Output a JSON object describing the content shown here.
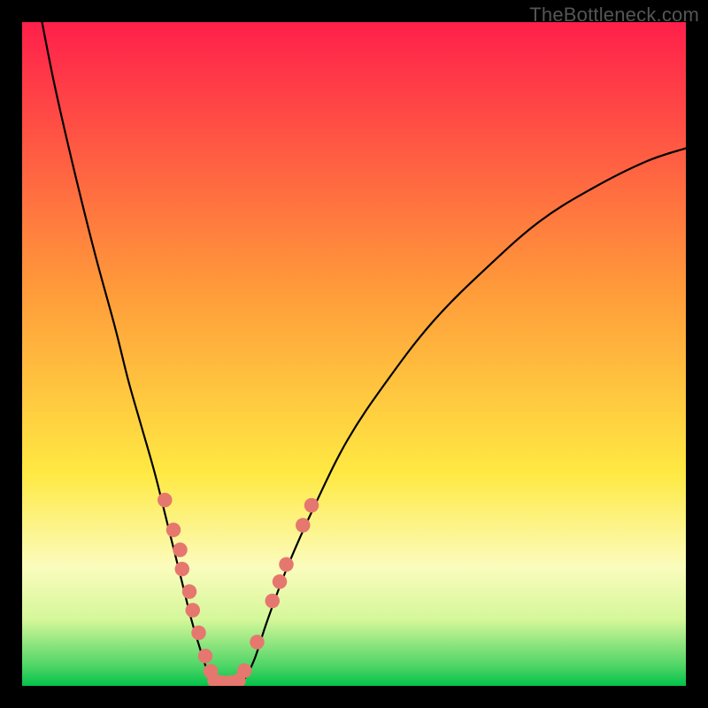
{
  "watermark": "TheBottleneck.com",
  "chart_data": {
    "type": "line",
    "title": "",
    "xlabel": "",
    "ylabel": "",
    "xlim": [
      0,
      100
    ],
    "ylim": [
      0,
      100
    ],
    "grid": false,
    "background_gradient": {
      "stops": [
        {
          "pct": 0,
          "color": "#ff1f4b"
        },
        {
          "pct": 40,
          "color": "#ff9a3a"
        },
        {
          "pct": 68,
          "color": "#ffe943"
        },
        {
          "pct": 82,
          "color": "#fbfcbd"
        },
        {
          "pct": 90,
          "color": "#d5f79a"
        },
        {
          "pct": 97,
          "color": "#4fd566"
        },
        {
          "pct": 100,
          "color": "#04c24a"
        }
      ]
    },
    "series": [
      {
        "name": "left-branch",
        "color": "#000000",
        "x": [
          3,
          5,
          8,
          11,
          14,
          16,
          18,
          20,
          22,
          24,
          25.5,
          27,
          28,
          28.8,
          29.5
        ],
        "y": [
          100,
          90,
          77,
          65,
          54,
          46,
          39,
          32,
          24,
          16,
          10,
          5,
          2,
          0.5,
          0
        ]
      },
      {
        "name": "right-branch",
        "color": "#000000",
        "x": [
          32.5,
          33.5,
          35,
          37,
          40,
          44,
          49,
          55,
          62,
          70,
          78,
          86,
          94,
          100
        ],
        "y": [
          0,
          1,
          4,
          10,
          18,
          27,
          37,
          46,
          55,
          63,
          70,
          75,
          79,
          81
        ]
      },
      {
        "name": "valley-floor",
        "color": "#000000",
        "x": [
          29.5,
          30.5,
          31.5,
          32.5
        ],
        "y": [
          0,
          0,
          0,
          0
        ]
      }
    ],
    "markers": {
      "name": "dots",
      "color": "#e6776e",
      "radius_pct": 1.1,
      "points": [
        {
          "x": 21.5,
          "y": 28
        },
        {
          "x": 22.8,
          "y": 23.5
        },
        {
          "x": 23.8,
          "y": 20.5
        },
        {
          "x": 24.1,
          "y": 17.6
        },
        {
          "x": 25.2,
          "y": 14.2
        },
        {
          "x": 25.7,
          "y": 11.4
        },
        {
          "x": 26.6,
          "y": 8.0
        },
        {
          "x": 27.6,
          "y": 4.5
        },
        {
          "x": 28.4,
          "y": 2.2
        },
        {
          "x": 29.0,
          "y": 0.8
        },
        {
          "x": 30.2,
          "y": 0.5
        },
        {
          "x": 31.4,
          "y": 0.5
        },
        {
          "x": 32.6,
          "y": 0.8
        },
        {
          "x": 33.5,
          "y": 2.3
        },
        {
          "x": 35.4,
          "y": 6.6
        },
        {
          "x": 37.7,
          "y": 12.8
        },
        {
          "x": 38.8,
          "y": 15.7
        },
        {
          "x": 39.8,
          "y": 18.3
        },
        {
          "x": 42.3,
          "y": 24.2
        },
        {
          "x": 43.6,
          "y": 27.2
        }
      ]
    }
  }
}
